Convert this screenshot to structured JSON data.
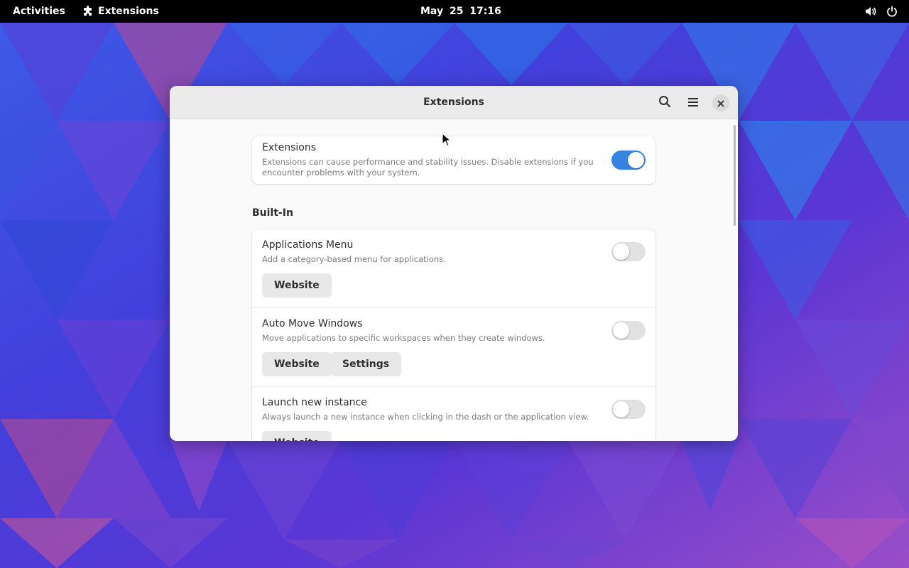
{
  "topbar": {
    "activities": "Activities",
    "app_name": "Extensions",
    "clock": "May 25  17:16",
    "icons": [
      "puzzle-icon",
      "volume-icon",
      "power-icon"
    ]
  },
  "window": {
    "title": "Extensions",
    "icons": [
      "search-icon",
      "hamburger-menu-icon",
      "close-icon"
    ],
    "master": {
      "title": "Extensions",
      "description_line1": "Extensions can cause performance and stability issues. Disable extensions if you",
      "description_line2": "encounter problems with your system.",
      "enabled": true
    },
    "section_title": "Built-In",
    "extensions": [
      {
        "name": "Applications Menu",
        "description": "Add a category-based menu for applications.",
        "enabled": false,
        "buttons": [
          "Website"
        ]
      },
      {
        "name": "Auto Move Windows",
        "description": "Move applications to specific workspaces when they create windows.",
        "enabled": false,
        "buttons": [
          "Website",
          "Settings"
        ]
      },
      {
        "name": "Launch new instance",
        "description": "Always launch a new instance when clicking in the dash or the application view.",
        "enabled": false,
        "buttons": [
          "Website"
        ]
      }
    ]
  },
  "colors": {
    "accent": "#3584e4",
    "topbar": "#000000",
    "window_bg": "#fafafa",
    "headerbar": "#ebebeb"
  }
}
